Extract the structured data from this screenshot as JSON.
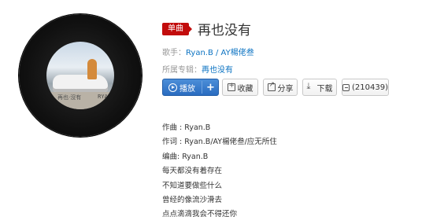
{
  "song": {
    "tag": "单曲",
    "title": "再也没有"
  },
  "meta": {
    "singer_label": "歌手：",
    "singer": "Ryan.B / AY楊佬叁",
    "album_label": "所属专辑：",
    "album": "再也没有"
  },
  "cover": {
    "caption": "再也·沒有",
    "brand": "RYAN"
  },
  "actions": {
    "play": "播放",
    "add": "+",
    "collect": "收藏",
    "share": "分享",
    "download": "下载",
    "comment_count": "(210439)"
  },
  "lyrics": [
    "作曲 : Ryan.B",
    "作词 : Ryan.B/AY楊佬叁/应无所住",
    "编曲: Ryan.B",
    "每天都没有着存在",
    "不知道要做些什么",
    "曾经的像流沙滑去",
    "点点滴滴我会不得还你"
  ],
  "colors": {
    "tag_red": "#c20c0c",
    "link_blue": "#0c73c2",
    "play_blue": "#2a6cc0"
  }
}
